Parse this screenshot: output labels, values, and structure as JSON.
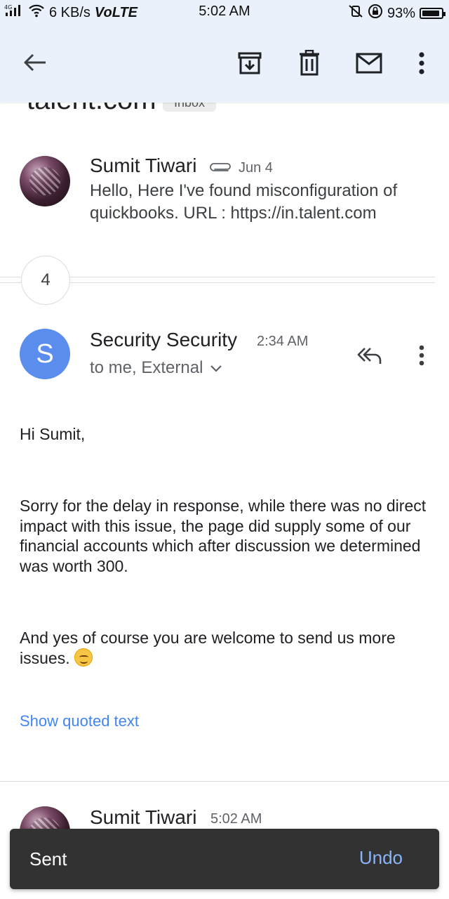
{
  "status_bar": {
    "network_type": "4G",
    "speed": "6 KB/s",
    "volte": "VoLTE",
    "time": "5:02 AM",
    "battery": "93%",
    "battery_level": 0.93
  },
  "app_bar": {
    "back_icon": "arrow-back-icon",
    "archive_icon": "archive-icon",
    "delete_icon": "trash-icon",
    "mark_unread_icon": "mail-icon",
    "more_icon": "more-vert-icon"
  },
  "thread": {
    "subject_fragment": "talent.com",
    "label_chip": "Inbox",
    "collapsed_message": {
      "sender": "Sumit Tiwari",
      "date": "Jun 4",
      "snippet": "Hello, Here I've found misconfiguration of quickbooks. URL : https://in.talent.com"
    },
    "hidden_count": "4",
    "open_message": {
      "avatar_letter": "S",
      "sender": "Security Security",
      "time": "2:34 AM",
      "recipients": "to me, External",
      "greeting": "Hi Sumit,",
      "paragraph_1": "Sorry for the delay in response, while there was no direct impact with this issue, the page did supply some of our financial accounts which after discussion we determined was worth 300.",
      "paragraph_2": "And yes of course you are welcome to send us more issues.",
      "show_quoted": "Show quoted text"
    },
    "next_message": {
      "sender": "Sumit Tiwari",
      "time": "5:02 AM"
    }
  },
  "snackbar": {
    "message": "Sent",
    "action": "Undo"
  },
  "colors": {
    "top_band": "#eaf1fb",
    "avatar_blue": "#5b8def",
    "link_blue": "#4285f4",
    "snackbar_bg": "#323232",
    "snackbar_action": "#8ab4f8"
  }
}
